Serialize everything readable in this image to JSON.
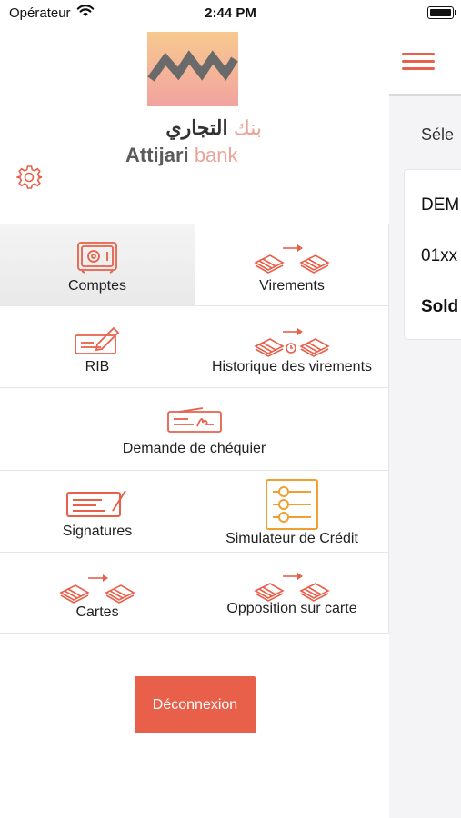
{
  "status_bar": {
    "carrier": "Opérateur",
    "time": "2:44 PM"
  },
  "brand": {
    "arabic_main": "التجاري",
    "arabic_secondary": "بنك",
    "latin_bold": "Attijari",
    "latin_light": "bank"
  },
  "menu": {
    "items": [
      {
        "label": "Comptes",
        "icon": "safe-icon",
        "active": true
      },
      {
        "label": "Virements",
        "icon": "money-transfer-icon"
      },
      {
        "label": "RIB",
        "icon": "check-edit-icon"
      },
      {
        "label": "Historique des virements",
        "icon": "transfer-history-icon"
      },
      {
        "label": "Demande de chéquier",
        "icon": "checkbook-icon"
      },
      {
        "label": "Signatures",
        "icon": "signature-check-icon"
      },
      {
        "label": "Simulateur de Crédit",
        "icon": "sliders-icon"
      },
      {
        "label": "Cartes",
        "icon": "money-transfer-icon"
      },
      {
        "label": "Opposition sur carte",
        "icon": "money-transfer-icon"
      }
    ],
    "logout_label": "Déconnexion"
  },
  "background_screen": {
    "select_label": "Séle",
    "account_line_1": "DEM",
    "account_line_2": "01xx",
    "account_line_3": "Sold"
  },
  "colors": {
    "accent": "#e8604a",
    "active_cell": "#ececec",
    "simulator_icon": "#f0a030"
  }
}
